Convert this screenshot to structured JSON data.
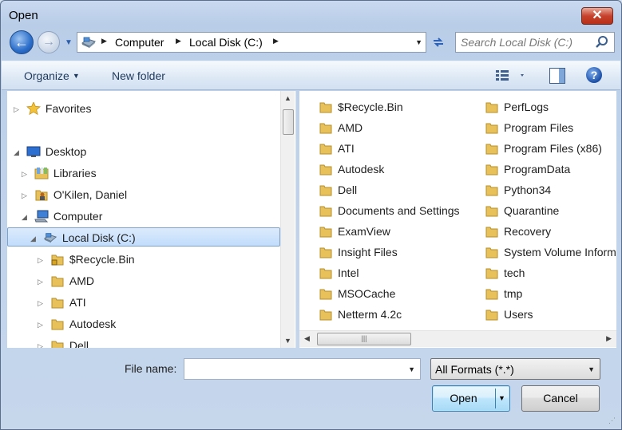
{
  "window": {
    "title": "Open",
    "close_symbol": "✕"
  },
  "nav": {
    "back_symbol": "←",
    "forward_symbol": "→",
    "breadcrumbs": [
      "Computer",
      "Local Disk (C:)"
    ],
    "search_placeholder": "Search Local Disk (C:)"
  },
  "toolbar": {
    "organize_label": "Organize",
    "new_folder_label": "New folder",
    "help_symbol": "?"
  },
  "tree": {
    "items": [
      {
        "label": "Favorites",
        "icon": "star-icon",
        "expander": "▷"
      },
      {
        "label": "Desktop",
        "icon": "desktop-icon",
        "expander": "◢"
      },
      {
        "label": "Libraries",
        "icon": "library-icon",
        "expander": "▷"
      },
      {
        "label": "O'Kilen, Daniel",
        "icon": "user-folder-icon",
        "expander": "▷"
      },
      {
        "label": "Computer",
        "icon": "computer-icon",
        "expander": "◢"
      },
      {
        "label": "Local Disk (C:)",
        "icon": "drive-icon",
        "expander": "◢"
      },
      {
        "label": "$Recycle.Bin",
        "icon": "locked-folder-icon",
        "expander": "▷"
      },
      {
        "label": "AMD",
        "icon": "folder-icon",
        "expander": "▷"
      },
      {
        "label": "ATI",
        "icon": "folder-icon",
        "expander": "▷"
      },
      {
        "label": "Autodesk",
        "icon": "folder-icon",
        "expander": "▷"
      },
      {
        "label": "Dell",
        "icon": "folder-icon",
        "expander": "▷"
      }
    ],
    "selected": "Local Disk (C:)"
  },
  "files": {
    "column1": [
      "$Recycle.Bin",
      "AMD",
      "ATI",
      "Autodesk",
      "Dell",
      "Documents and Settings",
      "ExamView",
      "Insight Files",
      "Intel",
      "MSOCache",
      "Netterm 4.2c"
    ],
    "column2": [
      "PerfLogs",
      "Program Files",
      "Program Files (x86)",
      "ProgramData",
      "Python34",
      "Quarantine",
      "Recovery",
      "System Volume Information",
      "tech",
      "tmp",
      "Users"
    ]
  },
  "footer": {
    "file_name_label": "File name:",
    "file_name_value": "",
    "filter_value": "All Formats (*.*)",
    "open_label": "Open",
    "cancel_label": "Cancel"
  },
  "colors": {
    "accent": "#2a6dc9",
    "folder": "#e8c15a",
    "selection": "#c1dcfc"
  }
}
